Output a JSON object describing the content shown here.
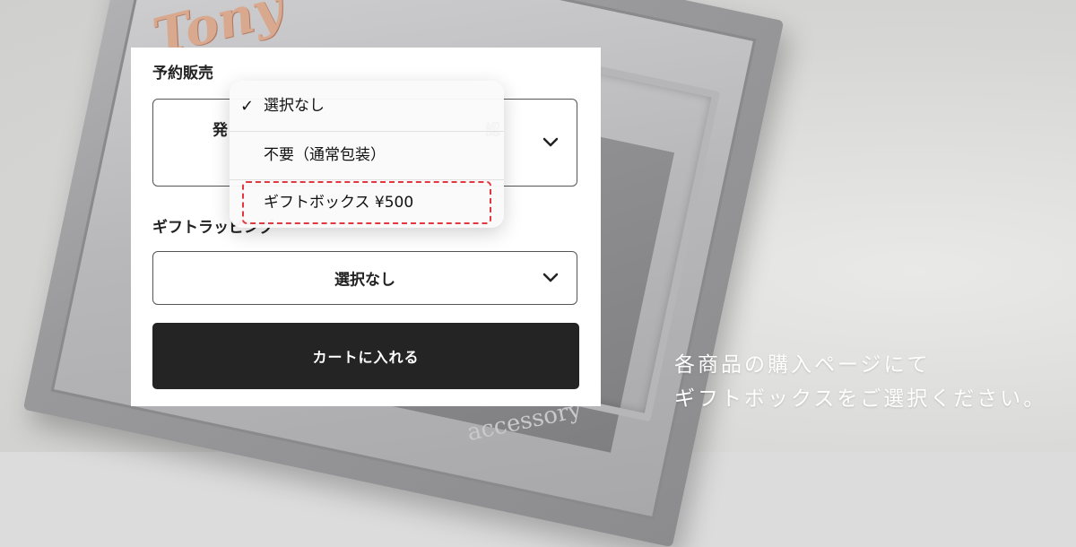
{
  "photo": {
    "necklace_text": "Tony",
    "brand_text": "accessory"
  },
  "caption": {
    "line1": "各商品の購入ページにて",
    "line2": "ギフトボックスをご選択ください。"
  },
  "form": {
    "preorder_label": "予約販売",
    "preorder_value_left": "発",
    "preorder_value_right": "認",
    "gift_label": "ギフトラッピング",
    "gift_value": "選択なし",
    "cart_button": "カートに入れる"
  },
  "dropdown": {
    "options": [
      {
        "label": "選択なし",
        "selected": true
      },
      {
        "label": "不要（通常包装）",
        "selected": false
      },
      {
        "label": "ギフトボックス ¥500",
        "selected": false,
        "highlighted": true
      }
    ],
    "check_icon": "checkmark-icon",
    "highlight_color": "#e2373f"
  },
  "colors": {
    "button_bg": "#242424",
    "caption_text": "#ffffff"
  }
}
